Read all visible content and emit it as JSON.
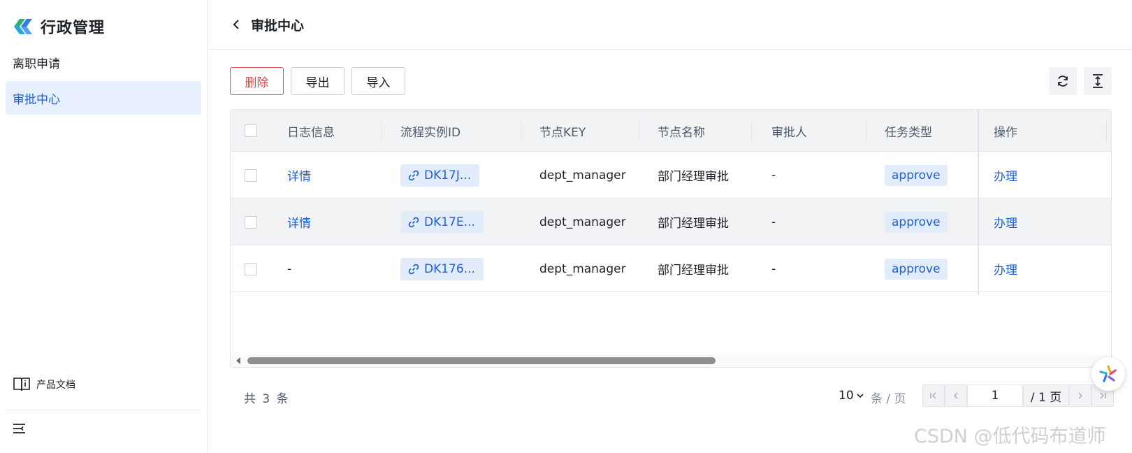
{
  "brand": {
    "title": "行政管理"
  },
  "sidebar": {
    "items": [
      {
        "label": "离职申请",
        "active": false
      },
      {
        "label": "审批中心",
        "active": true
      }
    ],
    "docs_label": "产品文档"
  },
  "header": {
    "title": "审批中心"
  },
  "toolbar": {
    "delete_label": "删除",
    "export_label": "导出",
    "import_label": "导入"
  },
  "table": {
    "columns": [
      "日志信息",
      "流程实例ID",
      "节点KEY",
      "节点名称",
      "审批人",
      "任务类型",
      "操作"
    ],
    "rows": [
      {
        "log": "详情",
        "instance_id": "DK17J...",
        "node_key": "dept_manager",
        "node_name": "部门经理审批",
        "approver": "-",
        "task_type": "approve",
        "action": "办理"
      },
      {
        "log": "详情",
        "instance_id": "DK17E...",
        "node_key": "dept_manager",
        "node_name": "部门经理审批",
        "approver": "-",
        "task_type": "approve",
        "action": "办理"
      },
      {
        "log": "-",
        "instance_id": "DK176...",
        "node_key": "dept_manager",
        "node_name": "部门经理审批",
        "approver": "-",
        "task_type": "approve",
        "action": "办理"
      }
    ]
  },
  "footer": {
    "total_text": "共 3 条",
    "page_size": "10",
    "page_unit": "条 / 页",
    "current_page": "1",
    "total_pages_text": "/ 1 页"
  },
  "watermark": "CSDN @低代码布道师",
  "colors": {
    "accent": "#1f5fcf",
    "danger": "#e04848",
    "active_bg": "#e8f0fd",
    "tag_bg": "#e3ecfb"
  },
  "icons": [
    "logo-icon",
    "back-icon",
    "refresh-icon",
    "row-height-icon",
    "link-icon",
    "book-icon",
    "menu-collapse-icon",
    "chevron-down-icon",
    "first-page-icon",
    "prev-page-icon",
    "next-page-icon",
    "last-page-icon",
    "assistant-icon"
  ]
}
